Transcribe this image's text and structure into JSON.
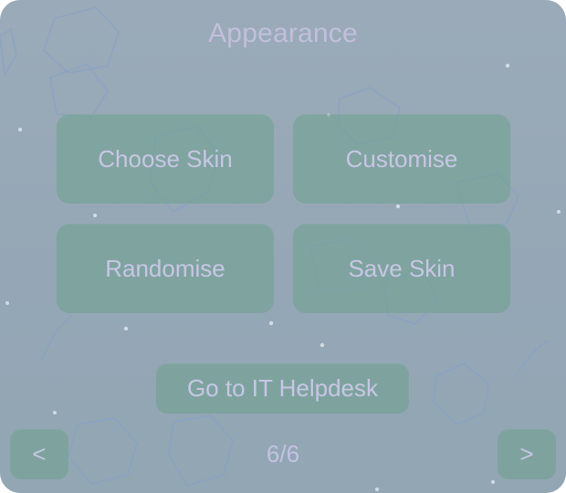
{
  "dialog": {
    "title": "Appearance"
  },
  "buttons": {
    "choose_skin": "Choose Skin",
    "customise": "Customise",
    "randomise": "Randomise",
    "save_skin": "Save Skin",
    "helpdesk": "Go to IT Helpdesk"
  },
  "pagination": {
    "prev": "<",
    "next": ">",
    "indicator": "6/6"
  },
  "colors": {
    "panel_background": "#96a8b6",
    "button_fill": "#6ea08c",
    "text": "#c4c2e2"
  }
}
